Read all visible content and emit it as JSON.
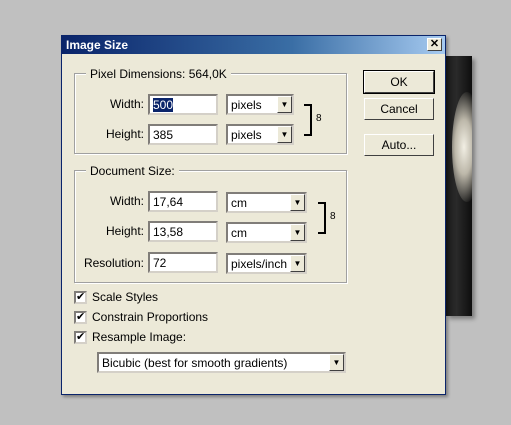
{
  "dialog": {
    "title": "Image Size",
    "close_glyph": "✕"
  },
  "pixel_dimensions": {
    "legend": "Pixel Dimensions:",
    "size": "564,0K",
    "width_label": "Width:",
    "width_value": "500",
    "width_unit": "pixels",
    "height_label": "Height:",
    "height_value": "385",
    "height_unit": "pixels"
  },
  "document_size": {
    "legend": "Document Size:",
    "width_label": "Width:",
    "width_value": "17,64",
    "width_unit": "cm",
    "height_label": "Height:",
    "height_value": "13,58",
    "height_unit": "cm",
    "resolution_label": "Resolution:",
    "resolution_value": "72",
    "resolution_unit": "pixels/inch"
  },
  "buttons": {
    "ok": "OK",
    "cancel": "Cancel",
    "auto": "Auto..."
  },
  "options": {
    "scale_styles": {
      "label": "Scale Styles",
      "checked": true
    },
    "constrain": {
      "label": "Constrain Proportions",
      "checked": true
    },
    "resample": {
      "label": "Resample Image:",
      "checked": true
    },
    "method": "Bicubic (best for smooth gradients)"
  },
  "glyphs": {
    "check": "✔",
    "arrow": "▼",
    "chain": "8"
  }
}
